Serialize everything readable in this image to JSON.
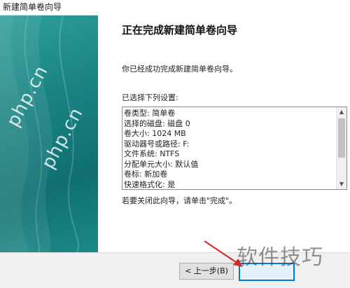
{
  "window": {
    "title": "新建简单卷向导"
  },
  "banner": {
    "watermark1": "php.cn",
    "watermark2": "php.cn"
  },
  "content": {
    "heading": "正在完成新建简单卷向导",
    "intro": "你已经成功完成新建简单卷向导。",
    "settings_label": "已选择下列设置:",
    "settings": [
      "卷类型: 简单卷",
      "选择的磁盘: 磁盘 0",
      "卷大小: 1024 MB",
      "驱动器号或路径: F:",
      "文件系统: NTFS",
      "分配单元大小: 默认值",
      "卷标: 新加卷",
      "快速格式化: 是"
    ],
    "close_hint": "若要关闭此向导，请单击\"完成\"。"
  },
  "footer": {
    "back_label": "< 上一步(B)",
    "finish_label": ""
  },
  "overlay": {
    "watermark": "软件技巧"
  },
  "colors": {
    "banner": "#1a8483",
    "accent": "#0078d7",
    "arrow": "#d9262b"
  }
}
